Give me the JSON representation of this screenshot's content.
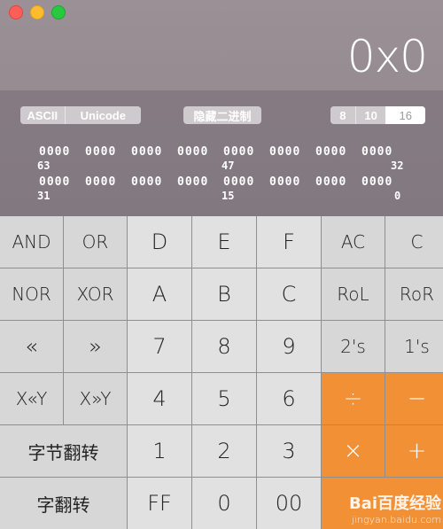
{
  "display": {
    "value": "0x0"
  },
  "encoding": {
    "ascii": "ASCII",
    "unicode": "Unicode"
  },
  "hide_binary": "隐藏二进制",
  "base": {
    "options": [
      "8",
      "10",
      "16"
    ],
    "selected": "16"
  },
  "bits": {
    "row1": [
      "0000",
      "0000",
      "0000",
      "0000",
      "0000",
      "0000",
      "0000",
      "0000"
    ],
    "row1_labels": [
      "63",
      "47",
      "32"
    ],
    "row2": [
      "0000",
      "0000",
      "0000",
      "0000",
      "0000",
      "0000",
      "0000",
      "0000"
    ],
    "row2_labels": [
      "31",
      "15",
      "0"
    ]
  },
  "keys": {
    "and": "AND",
    "or": "OR",
    "d": "D",
    "e": "E",
    "f": "F",
    "ac": "AC",
    "c_clear": "C",
    "nor": "NOR",
    "xor": "XOR",
    "a": "A",
    "b": "B",
    "c": "C",
    "rol": "RoL",
    "ror": "RoR",
    "shl": "«",
    "shr": "»",
    "k7": "7",
    "k8": "8",
    "k9": "9",
    "twos": "2's",
    "ones": "1's",
    "xshly": "X«Y",
    "xshry": "X»Y",
    "k4": "4",
    "k5": "5",
    "k6": "6",
    "div": "÷",
    "minus": "−",
    "byte_swap": "字节翻转",
    "k1": "1",
    "k2": "2",
    "k3": "3",
    "mul": "×",
    "plus": "+",
    "word_swap": "字翻转",
    "ff": "FF",
    "k0": "0",
    "k00": "00"
  },
  "watermark": {
    "main": "Bai百度经验",
    "sub": "jingyan.baidu.com"
  }
}
